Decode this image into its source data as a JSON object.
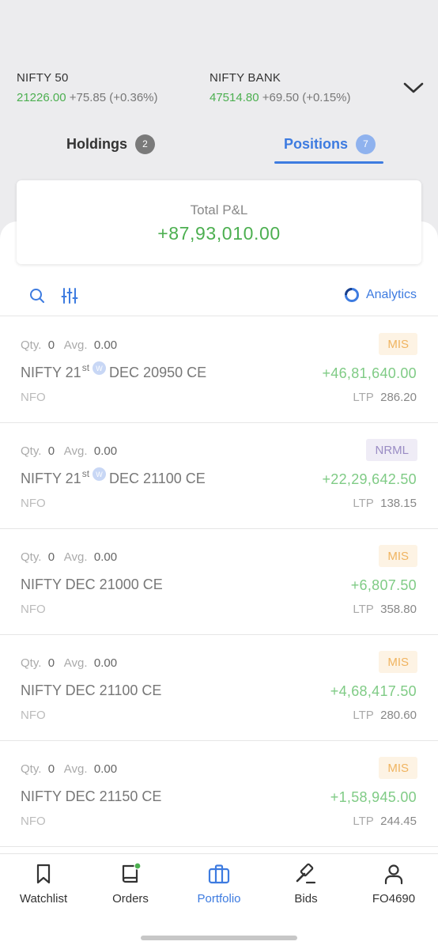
{
  "indices": [
    {
      "name": "NIFTY 50",
      "ltp": "21226.00",
      "change": "+75.85 (+0.36%)"
    },
    {
      "name": "NIFTY BANK",
      "ltp": "47514.80",
      "change": "+69.50 (+0.15%)"
    }
  ],
  "tabs": {
    "holdings": {
      "label": "Holdings",
      "count": "2"
    },
    "positions": {
      "label": "Positions",
      "count": "7"
    }
  },
  "pnl_card": {
    "label": "Total P&L",
    "value": "+87,93,010.00"
  },
  "toolbar": {
    "analytics_label": "Analytics"
  },
  "positions": [
    {
      "qty_label": "Qty.",
      "qty": "0",
      "avg_label": "Avg.",
      "avg": "0.00",
      "product": "MIS",
      "inst_prefix": "NIFTY 21",
      "inst_sup": "st",
      "weekly": "W",
      "inst_suffix": "DEC 20950 CE",
      "pnl": "+46,81,640.00",
      "exchange": "NFO",
      "ltp_label": "LTP",
      "ltp": "286.20"
    },
    {
      "qty_label": "Qty.",
      "qty": "0",
      "avg_label": "Avg.",
      "avg": "0.00",
      "product": "NRML",
      "inst_prefix": "NIFTY 21",
      "inst_sup": "st",
      "weekly": "W",
      "inst_suffix": "DEC 21100 CE",
      "pnl": "+22,29,642.50",
      "exchange": "NFO",
      "ltp_label": "LTP",
      "ltp": "138.15"
    },
    {
      "qty_label": "Qty.",
      "qty": "0",
      "avg_label": "Avg.",
      "avg": "0.00",
      "product": "MIS",
      "inst_full": "NIFTY DEC 21000 CE",
      "pnl": "+6,807.50",
      "exchange": "NFO",
      "ltp_label": "LTP",
      "ltp": "358.80"
    },
    {
      "qty_label": "Qty.",
      "qty": "0",
      "avg_label": "Avg.",
      "avg": "0.00",
      "product": "MIS",
      "inst_full": "NIFTY DEC 21100 CE",
      "pnl": "+4,68,417.50",
      "exchange": "NFO",
      "ltp_label": "LTP",
      "ltp": "280.60"
    },
    {
      "qty_label": "Qty.",
      "qty": "0",
      "avg_label": "Avg.",
      "avg": "0.00",
      "product": "MIS",
      "inst_full": "NIFTY DEC 21150 CE",
      "pnl": "+1,58,945.00",
      "exchange": "NFO",
      "ltp_label": "LTP",
      "ltp": "244.45"
    }
  ],
  "bottom_nav": [
    {
      "label": "Watchlist",
      "icon": "bookmark-icon"
    },
    {
      "label": "Orders",
      "icon": "book-icon"
    },
    {
      "label": "Portfolio",
      "icon": "briefcase-icon"
    },
    {
      "label": "Bids",
      "icon": "gavel-icon"
    },
    {
      "label": "FO4690",
      "icon": "user-icon"
    }
  ],
  "colors": {
    "accent": "#3d7be0",
    "profit": "#4caf50",
    "mis": "#f0b460",
    "nrml": "#9a8cc4",
    "notification_dot": "#4caf50"
  }
}
